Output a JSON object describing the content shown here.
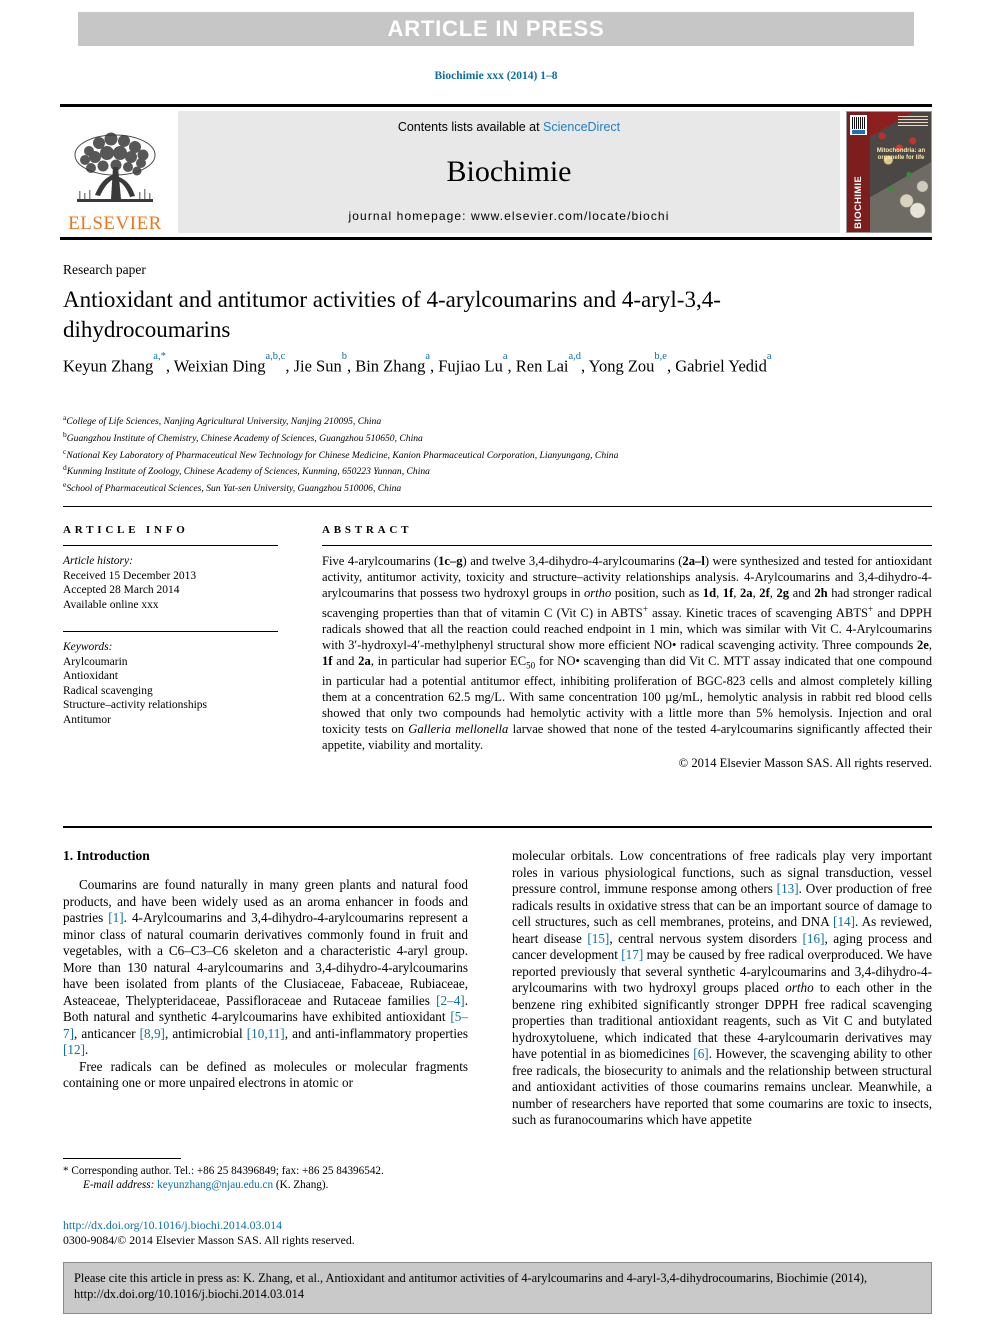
{
  "banner": {
    "label": "ARTICLE IN PRESS"
  },
  "journal_ref": "Biochimie xxx (2014) 1–8",
  "masthead": {
    "contents_prefix": "Contents lists available at ",
    "contents_link": "ScienceDirect",
    "journal_title": "Biochimie",
    "homepage": "journal homepage: www.elsevier.com/locate/biochi",
    "publisher": "ELSEVIER",
    "cover_spine": "BIOCHIMIE",
    "cover_caption": "Mitochondria: an organelle for life"
  },
  "article": {
    "type": "Research paper",
    "title": "Antioxidant and antitumor activities of 4-arylcoumarins and 4-aryl-3,4-dihydrocoumarins",
    "authors_html": "Keyun Zhang<sup>a,*</sup>, Weixian Ding<sup>a,b,c</sup>, Jie Sun<sup>b</sup>, Bin Zhang<sup>a</sup>, Fujiao Lu<sup>a</sup>, Ren Lai<sup>a,d</sup>, Yong Zou<sup>b,e</sup>, Gabriel Yedid<sup>a</sup>",
    "affiliations": [
      {
        "mark": "a",
        "text": "College of Life Sciences, Nanjing Agricultural University, Nanjing 210095, China"
      },
      {
        "mark": "b",
        "text": "Guangzhou Institute of Chemistry, Chinese Academy of Sciences, Guangzhou 510650, China"
      },
      {
        "mark": "c",
        "text": "National Key Laboratory of Pharmaceutical New Technology for Chinese Medicine, Kanion Pharmaceutical Corporation, Lianyungang, China"
      },
      {
        "mark": "d",
        "text": "Kunming Institute of Zoology, Chinese Academy of Sciences, Kunming, 650223 Yunnan, China"
      },
      {
        "mark": "e",
        "text": "School of Pharmaceutical Sciences, Sun Yat-sen University, Guangzhou 510006, China"
      }
    ]
  },
  "article_info": {
    "heading": "ARTICLE INFO",
    "history_label": "Article history:",
    "history": [
      "Received 15 December 2013",
      "Accepted 28 March 2014",
      "Available online xxx"
    ],
    "keywords_label": "Keywords:",
    "keywords": [
      "Arylcoumarin",
      "Antioxidant",
      "Radical scavenging",
      "Structure–activity relationships",
      "Antitumor"
    ]
  },
  "abstract": {
    "heading": "ABSTRACT",
    "html": "Five 4-arylcoumarins (<b>1c&ndash;g</b>) and twelve 3,4-dihydro-4-arylcoumarins (<b>2a&ndash;l</b>) were synthesized and tested for antioxidant activity, antitumor activity, toxicity and structure&ndash;activity relationships analysis. 4-Arylcoumarins and 3,4-dihydro-4-arylcoumarins that possess two hydroxyl groups in <i>ortho</i> position, such as <b>1d</b>, <b>1f</b>, <b>2a</b>, <b>2f</b>, <b>2g</b> and <b>2h</b> had stronger radical scavenging properties than that of vitamin C (Vit C) in ABTS<sup>+</sup> assay. Kinetic traces of scavenging ABTS<sup>+</sup> and DPPH radicals showed that all the reaction could reached endpoint in 1 min, which was similar with Vit C. 4-Arylcoumarins with 3&prime;-hydroxyl-4&prime;-methylphenyl structural show more efficient NO&bull; radical scavenging activity. Three compounds <b>2e</b>, <b>1f</b> and <b>2a</b>, in particular had superior EC<sub>50</sub> for NO&bull; scavenging than did Vit C. MTT assay indicated that one compound in particular had a potential antitumor effect, inhibiting proliferation of BGC-823 cells and almost completely killing them at a concentration 62.5 mg/L. With same concentration 100 &micro;g/mL, hemolytic analysis in rabbit red blood cells showed that only two compounds had hemolytic activity with a little more than 5% hemolysis. Injection and oral toxicity tests on <i>Galleria mellonella</i> larvae showed that none of the tested 4-arylcoumarins significantly affected their appetite, viability and mortality.",
    "copyright": "© 2014 Elsevier Masson SAS. All rights reserved."
  },
  "body": {
    "section_number_title": "1. Introduction",
    "left_paragraphs_html": [
      "Coumarins are found naturally in many green plants and natural food products, and have been widely used as an aroma enhancer in foods and pastries <span class=\"ref\">[1]</span>. 4-Arylcoumarins and 3,4-dihydro-4-arylcoumarins represent a minor class of natural coumarin derivatives commonly found in fruit and vegetables, with a C6&ndash;C3&ndash;C6 skeleton and a characteristic 4-aryl group. More than 130 natural 4-arylcoumarins and 3,4-dihydro-4-arylcoumarins have been isolated from plants of the Clusiaceae, Fabaceae, Rubiaceae, Asteaceae, Thelypteridaceae, Passifloraceae and Rutaceae families <span class=\"ref\">[2&ndash;4]</span>. Both natural and synthetic 4-arylcoumarins have exhibited antioxidant <span class=\"ref\">[5&ndash;7]</span>, anticancer <span class=\"ref\">[8,9]</span>, antimicrobial <span class=\"ref\">[10,11]</span>, and anti-inflammatory properties <span class=\"ref\">[12]</span>.",
      "Free radicals can be defined as molecules or molecular fragments containing one or more unpaired electrons in atomic or"
    ],
    "right_paragraphs_html": [
      "molecular orbitals. Low concentrations of free radicals play very important roles in various physiological functions, such as signal transduction, vessel pressure control, immune response among others <span class=\"ref\">[13]</span>. Over production of free radicals results in oxidative stress that can be an important source of damage to cell structures, such as cell membranes, proteins, and DNA <span class=\"ref\">[14]</span>. As reviewed, heart disease <span class=\"ref\">[15]</span>, central nervous system disorders <span class=\"ref\">[16]</span>, aging process and cancer development <span class=\"ref\">[17]</span> may be caused by free radical overproduced. We have reported previously that several synthetic 4-arylcoumarins and 3,4-dihydro-4-arylcoumarins with two hydroxyl groups placed <i>ortho</i> to each other in the benzene ring exhibited significantly stronger DPPH free radical scavenging properties than traditional antioxidant reagents, such as Vit C and butylated hydroxytoluene, which indicated that these 4-arylcoumarin derivatives may have potential in as biomedicines <span class=\"ref\">[6]</span>. However, the scavenging ability to other free radicals, the biosecurity to animals and the relationship between structural and antioxidant activities of those coumarins remains unclear. Meanwhile, a number of researchers have reported that some coumarins are toxic to insects, such as furanocoumarins which have appetite"
    ]
  },
  "footnote": {
    "corresponding_html": "* Corresponding author. Tel.: +86 25 84396849; fax: +86 25 84396542.",
    "email_label": "E-mail address:",
    "email": "keyunzhang@njau.edu.cn",
    "email_suffix": "(K. Zhang)."
  },
  "doi": {
    "url": "http://dx.doi.org/10.1016/j.biochi.2014.03.014",
    "issn_line": "0300-9084/© 2014 Elsevier Masson SAS. All rights reserved."
  },
  "cite_box": {
    "text": "Please cite this article in press as: K. Zhang, et al., Antioxidant and antitumor activities of 4-arylcoumarins and 4-aryl-3,4-dihydrocoumarins, Biochimie (2014), http://dx.doi.org/10.1016/j.biochi.2014.03.014"
  },
  "colors": {
    "link": "#0b6ea8",
    "banner_bg": "#c6c6c6",
    "elsevier_orange": "#E87722",
    "cite_bg": "#c9c9c9"
  }
}
